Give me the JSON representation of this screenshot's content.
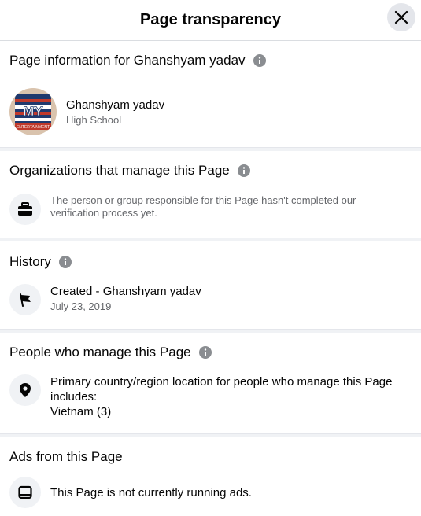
{
  "header": {
    "title": "Page transparency"
  },
  "page_info": {
    "title": "Page information for Ghanshyam yadav",
    "page_name": "Ghanshyam yadav",
    "category": "High School",
    "avatar_text": "MY",
    "avatar_subtext": "ENTERTAINMENT"
  },
  "organizations": {
    "title": "Organizations that manage this Page",
    "text": "The person or group responsible for this Page hasn't completed our verification process yet."
  },
  "history": {
    "title": "History",
    "created": "Created - Ghanshyam yadav",
    "date": "July 23, 2019"
  },
  "people": {
    "title": "People who manage this Page",
    "text": "Primary country/region location for people who manage this Page includes:",
    "location": "Vietnam (3)"
  },
  "ads": {
    "title": "Ads from this Page",
    "text": "This Page is not currently running ads."
  }
}
